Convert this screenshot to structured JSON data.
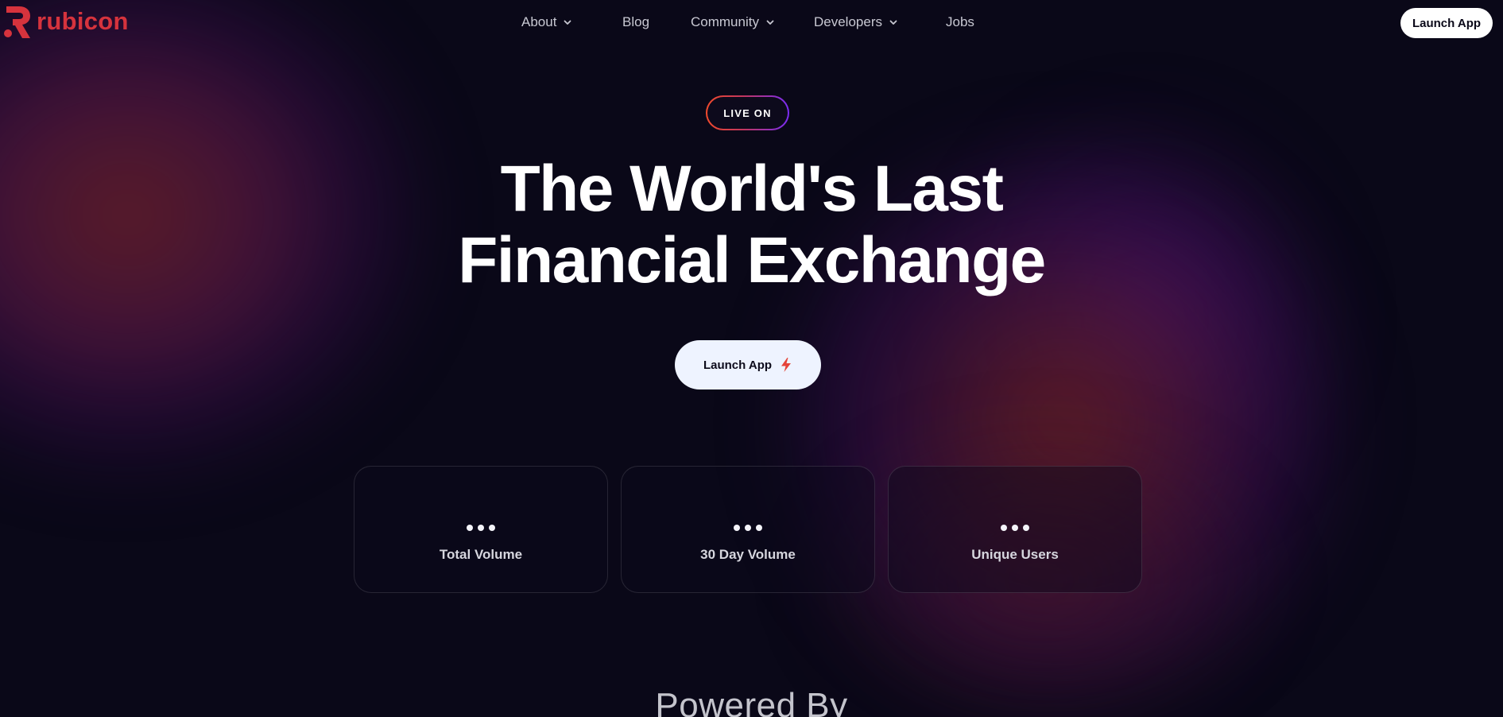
{
  "brand": {
    "name": "rubicon",
    "color": "#d6333d"
  },
  "nav": {
    "items": [
      {
        "label": "About",
        "has_dropdown": true
      },
      {
        "label": "Blog",
        "has_dropdown": false
      },
      {
        "label": "Community",
        "has_dropdown": true
      },
      {
        "label": "Developers",
        "has_dropdown": true
      },
      {
        "label": "Jobs",
        "has_dropdown": false
      }
    ],
    "launch_label": "Launch App"
  },
  "hero": {
    "badge": "LIVE ON",
    "headline_line1": "The World's Last",
    "headline_line2": "Financial Exchange",
    "cta_label": "Launch App",
    "cta_icon": "lightning-icon"
  },
  "stats": [
    {
      "value": "•••",
      "label": "Total Volume"
    },
    {
      "value": "•••",
      "label": "30 Day Volume"
    },
    {
      "value": "•••",
      "label": "Unique Users"
    }
  ],
  "powered_by": "Powered By",
  "colors": {
    "background": "#0a0818",
    "badge_gradient": [
      "#f24a2c",
      "#7a2cf5"
    ],
    "cta_background": "#eef3ff",
    "cta_icon": "#e5443a"
  }
}
